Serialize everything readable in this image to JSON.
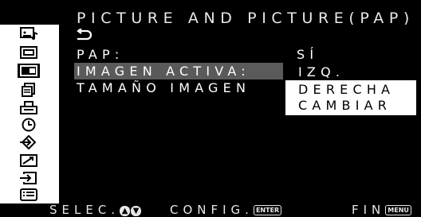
{
  "title": "PICTURE AND PICTURE(PAP)",
  "back_icon": "return-arrow-icon",
  "menu": {
    "pap_label": "PAP:",
    "pap_value": "SÍ",
    "active_label": "IMAGEN ACTIVA:",
    "size_label": "TAMAÑO IMAGEN"
  },
  "dropdown": {
    "options": [
      "IZQ.",
      "DERECHA",
      "CAMBIAR"
    ],
    "selected": "IZQ."
  },
  "sidebar_icons": [
    "picture-sound-icon",
    "screen-icon",
    "pip-icon",
    "document-icon",
    "printer-icon",
    "clock-icon",
    "input-icon",
    "signal-icon",
    "enter-icon",
    "list-icon"
  ],
  "footer": {
    "select_label": "SELEC.",
    "config_label": "CONFIG.",
    "enter_key": "ENTER",
    "end_label": "FIN",
    "menu_key": "MENU"
  },
  "colors": {
    "background": "#000000",
    "highlight": "#5a5a5a",
    "text": "#ffffff"
  }
}
